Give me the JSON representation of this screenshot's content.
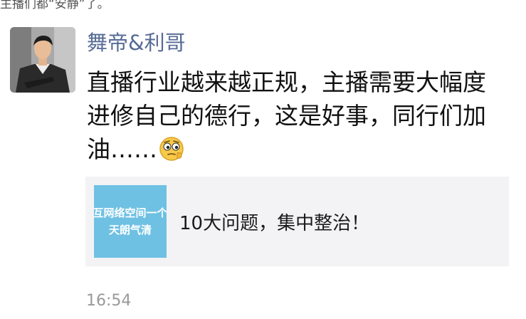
{
  "header": {
    "cut_text": "主播们都“安静”了。"
  },
  "post": {
    "author": "舞帝&利哥",
    "lines": [
      "直播行业越来越正规，主播需要大幅度",
      "进修自己的德行，这是好事，同行们加",
      "油……"
    ],
    "emoji_icon": "thinking-face-emoji",
    "time": "16:54"
  },
  "share": {
    "thumb_line1": "互网络空间一个",
    "thumb_line2": "天朗气清",
    "title": "10大问题，集中整治！"
  },
  "colors": {
    "name": "#576b95",
    "thumb": "#6fc1e3",
    "card": "#f3f3f5"
  }
}
